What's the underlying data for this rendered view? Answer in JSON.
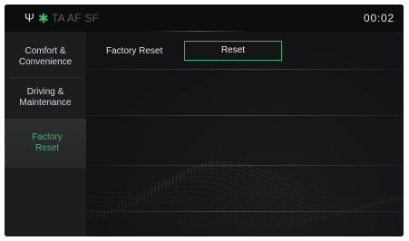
{
  "status_bar": {
    "usb_icon": "usb-icon",
    "bluetooth_icon": "bluetooth-icon",
    "indicators": "TA AF SF",
    "clock": "00:02",
    "accent_color": "#35c06b"
  },
  "sidebar": {
    "items": [
      {
        "label": "Comfort &\nConvenience",
        "selected": false
      },
      {
        "label": "Driving &\nMaintenance",
        "selected": false
      },
      {
        "label": "Factory\nReset",
        "selected": true
      }
    ]
  },
  "main": {
    "row_label": "Factory Reset",
    "reset_button": "Reset",
    "accent_color": "#2fb77a"
  }
}
